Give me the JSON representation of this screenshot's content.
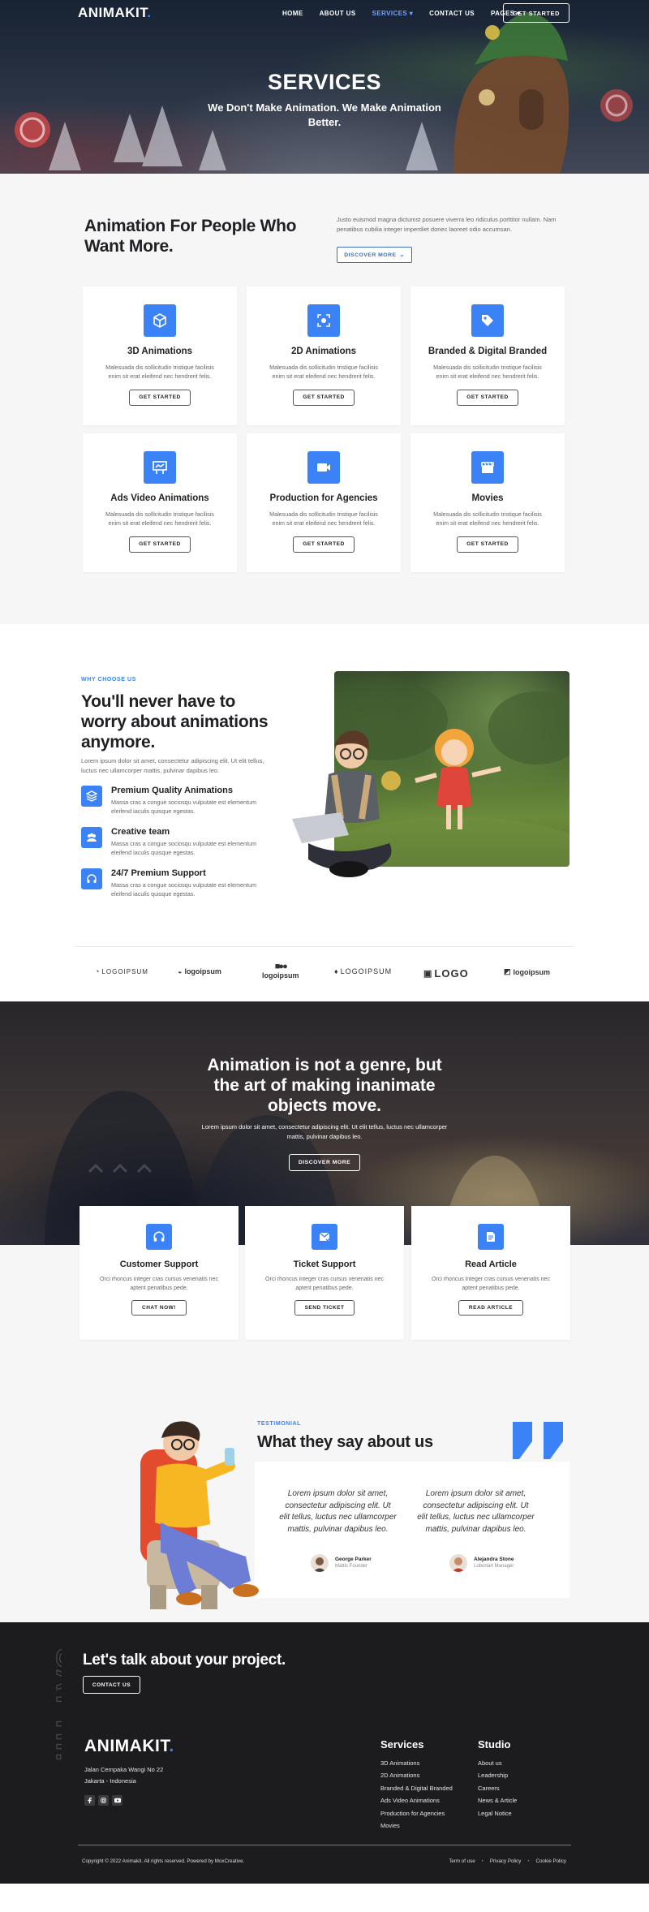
{
  "brand": {
    "name": "ANIMAKIT",
    "dot": ".",
    "accent": "#3b82f6"
  },
  "nav": {
    "items": [
      {
        "label": "HOME"
      },
      {
        "label": "ABOUT US"
      },
      {
        "label": "SERVICES",
        "active": true
      },
      {
        "label": "CONTACT US"
      },
      {
        "label": "PAGES"
      }
    ],
    "cta": "GET STARTED"
  },
  "hero": {
    "title": "SERVICES",
    "subtitle": "We Don't Make Animation. We Make Animation Better."
  },
  "services": {
    "heading": "Animation For People Who Want More.",
    "text": "Justo euismod magna dictumst posuere viverra leo ridiculus porttitor nullam. Nam penatibus cubilia integer imperdiet donec laoreet odio accumsan.",
    "button": "DISCOVER MORE",
    "cards": [
      {
        "icon": "cube-icon",
        "title": "3D Animations",
        "text": "Malesuada dis sollicitudin tristique facilisis enim sit erat eleifend nec hendrerit felis.",
        "button": "GET STARTED"
      },
      {
        "icon": "focus-icon",
        "title": "2D Animations",
        "text": "Malesuada dis sollicitudin tristique facilisis enim sit erat eleifend nec hendrerit felis.",
        "button": "GET STARTED"
      },
      {
        "icon": "tag-icon",
        "title": "Branded & Digital Branded",
        "text": "Malesuada dis sollicitudin tristique facilisis enim sit erat eleifend nec hendrerit felis.",
        "button": "GET STARTED"
      },
      {
        "icon": "billboard-icon",
        "title": "Ads Video Animations",
        "text": "Malesuada dis sollicitudin tristique facilisis enim sit erat eleifend nec hendrerit felis.",
        "button": "GET STARTED"
      },
      {
        "icon": "video-icon",
        "title": "Production for Agencies",
        "text": "Malesuada dis sollicitudin tristique facilisis enim sit erat eleifend nec hendrerit felis.",
        "button": "GET STARTED"
      },
      {
        "icon": "clapperboard-icon",
        "title": "Movies",
        "text": "Malesuada dis sollicitudin tristique facilisis enim sit erat eleifend nec hendrerit felis.",
        "button": "GET STARTED"
      }
    ]
  },
  "why": {
    "eyebrow": "WHY CHOOSE US",
    "heading": "You'll never have to worry about animations anymore.",
    "lead": "Lorem ipsum dolor sit amet, consectetur adipiscing elit. Ut elit tellus, luctus nec ullamcorper mattis, pulvinar dapibus leo.",
    "features": [
      {
        "icon": "layers-icon",
        "title": "Premium Quality Animations",
        "text": "Massa cras a congue sociosqu vulputate est elementum eleifend iaculis quisque egestas."
      },
      {
        "icon": "team-icon",
        "title": "Creative team",
        "text": "Massa cras a congue sociosqu vulputate est elementum eleifend iaculis quisque egestas."
      },
      {
        "icon": "headset-icon",
        "title": "24/7 Premium Support",
        "text": "Massa cras a congue sociosqu vulputate est elementum eleifend iaculis quisque egestas."
      }
    ],
    "client_logos": [
      "LOGOIPSUM",
      "logoipsum",
      "logoipsum",
      "LOGOIPSUM",
      "LOGO",
      "logoipsum"
    ]
  },
  "quote": {
    "title": "Animation is not a genre, but the art of making inanimate objects move.",
    "text": "Lorem ipsum dolor sit amet, consectetur adipiscing elit. Ut elit tellus, luctus nec ullamcorper mattis, pulvinar dapibus leo.",
    "button": "DISCOVER MORE"
  },
  "support": [
    {
      "icon": "headset-icon",
      "title": "Customer Support",
      "text": "Orci rhoncus integer cras cursus venenatis nec aptent penatibus pede.",
      "button": "CHAT NOW!"
    },
    {
      "icon": "ticket-icon",
      "title": "Ticket Support",
      "text": "Orci rhoncus integer cras cursus venenatis nec aptent penatibus pede.",
      "button": "SEND TICKET"
    },
    {
      "icon": "article-icon",
      "title": "Read Article",
      "text": "Orci rhoncus integer cras cursus venenatis nec aptent penatibus pede.",
      "button": "READ ARTICLE"
    }
  ],
  "testimonial": {
    "eyebrow": "TESTIMONIAL",
    "heading": "What they say about us",
    "items": [
      {
        "quote": "Lorem ipsum dolor sit amet, consectetur adipiscing elit. Ut elit tellus, luctus nec ullamcorper mattis, pulvinar dapibus leo.",
        "name": "George Parker",
        "role": "Mattis Founder"
      },
      {
        "quote": "Lorem ipsum dolor sit amet, consectetur adipiscing elit. Ut elit tellus, luctus nec ullamcorper mattis, pulvinar dapibus leo.",
        "name": "Alejandra Stone",
        "role": "Lobortart Manager"
      }
    ]
  },
  "footer": {
    "vertical_text": "SAY HI!",
    "cta": "Let's talk about your project.",
    "cta_button": "CONTACT US",
    "address_line1": "Jalan Cempaka Wangi No 22",
    "address_line2": "Jakarta - Indonesia",
    "services_title": "Services",
    "services_links": [
      "3D Animations",
      "2D Animations",
      "Branded & Digital Branded",
      "Ads Video Animations",
      "Production for Agencies",
      "Movies"
    ],
    "studio_title": "Studio",
    "studio_links": [
      "About us",
      "Leadership",
      "Careers",
      "News & Article",
      "Legal Notice"
    ],
    "copyright": "Copyright © 2022 Animakit. All rights reserved. Powered by MoxCreative.",
    "legal_links": [
      "Term of use",
      "Privacy Policy",
      "Cookie Policy"
    ]
  }
}
